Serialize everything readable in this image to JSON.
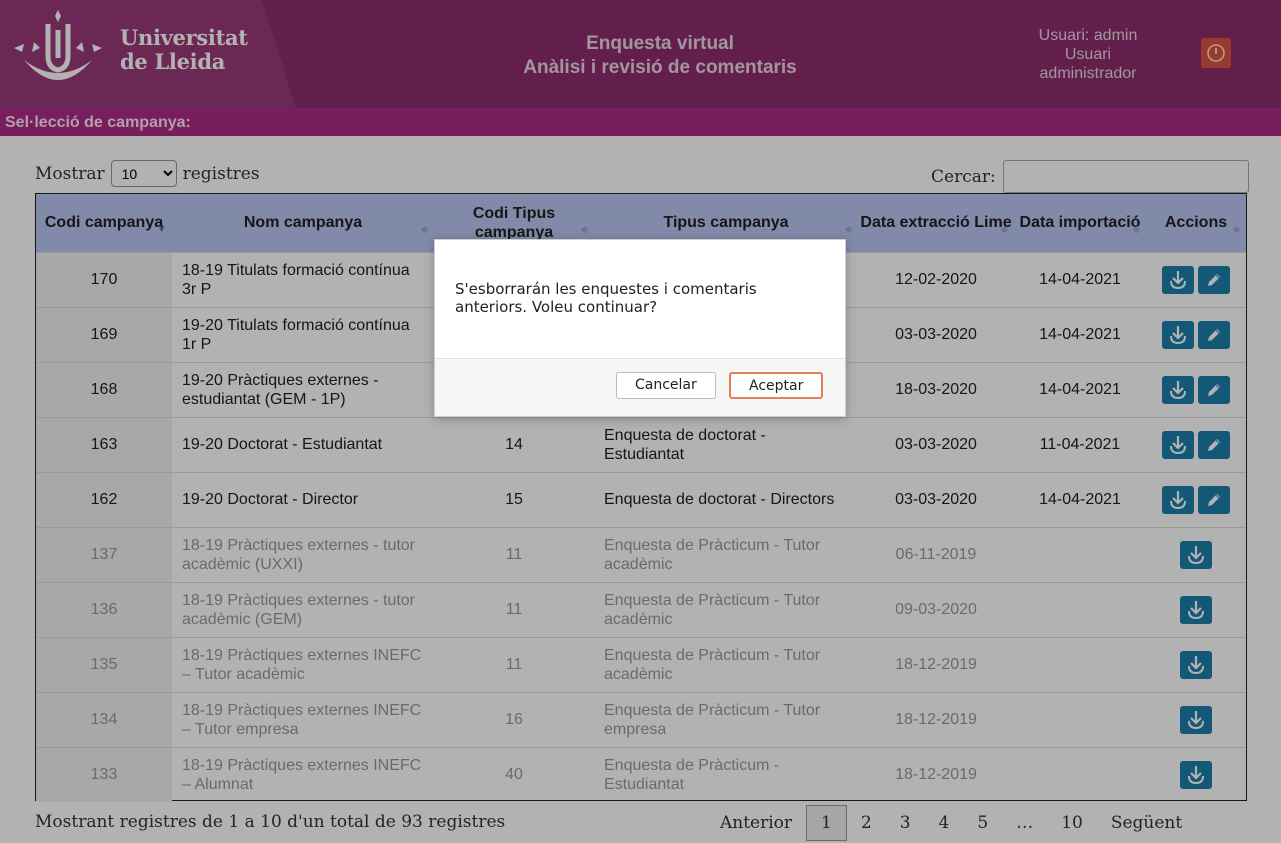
{
  "header": {
    "logo_line1": "Universitat",
    "logo_line2": "de Lleida",
    "title_line1": "Enquesta virtual",
    "title_line2": "Anàlisi i revisió de comentaris",
    "user_line1": "Usuari: admin",
    "user_line2": "Usuari",
    "user_line3": "administrador",
    "logout_icon": "power-icon"
  },
  "campaign_bar": {
    "label": "Sel·lecció de campanya:"
  },
  "controls": {
    "show_label": "Mostrar",
    "show_value": "10",
    "records_label": "registres",
    "search_label": "Cercar:",
    "search_value": ""
  },
  "table": {
    "headers": [
      "Codi campanya",
      "Nom campanya",
      "Codi Tipus campanya",
      "Tipus campanya",
      "Data extracció Lime",
      "Data importació",
      "Accions"
    ],
    "rows": [
      {
        "code": "170",
        "name": "18-19 Titulats formació contínua 3r P",
        "type_code": "",
        "type": "",
        "extract": "12-02-2020",
        "import": "14-04-2021",
        "editable": true
      },
      {
        "code": "169",
        "name": "19-20 Titulats formació contínua 1r P",
        "type_code": "",
        "type": "",
        "extract": "03-03-2020",
        "import": "14-04-2021",
        "editable": true
      },
      {
        "code": "168",
        "name": "19-20 Pràctiques externes - estudiantat (GEM - 1P)",
        "type_code": "",
        "type": "",
        "extract": "18-03-2020",
        "import": "14-04-2021",
        "editable": true
      },
      {
        "code": "163",
        "name": "19-20 Doctorat - Estudiantat",
        "type_code": "14",
        "type": "Enquesta de doctorat - Estudiantat",
        "extract": "03-03-2020",
        "import": "11-04-2021",
        "editable": true
      },
      {
        "code": "162",
        "name": "19-20 Doctorat - Director",
        "type_code": "15",
        "type": "Enquesta de doctorat - Directors",
        "extract": "03-03-2020",
        "import": "14-04-2021",
        "editable": true
      },
      {
        "code": "137",
        "name": "18-19 Pràctiques externes - tutor acadèmic (UXXI)",
        "type_code": "11",
        "type": "Enquesta de Pràcticum - Tutor acadèmic",
        "extract": "06-11-2019",
        "import": "",
        "editable": false
      },
      {
        "code": "136",
        "name": "18-19 Pràctiques externes - tutor acadèmic (GEM)",
        "type_code": "11",
        "type": "Enquesta de Pràcticum - Tutor acadèmic",
        "extract": "09-03-2020",
        "import": "",
        "editable": false
      },
      {
        "code": "135",
        "name": "18-19 Pràctiques externes INEFC – Tutor acadèmic",
        "type_code": "11",
        "type": "Enquesta de Pràcticum - Tutor acadèmic",
        "extract": "18-12-2019",
        "import": "",
        "editable": false
      },
      {
        "code": "134",
        "name": "18-19 Pràctiques externes INEFC – Tutor empresa",
        "type_code": "16",
        "type": "Enquesta de Pràcticum - Tutor empresa",
        "extract": "18-12-2019",
        "import": "",
        "editable": false
      },
      {
        "code": "133",
        "name": "18-19 Pràctiques externes INEFC – Alumnat",
        "type_code": "40",
        "type": "Enquesta de Pràcticum - Estudiantat",
        "extract": "18-12-2019",
        "import": "",
        "editable": false
      }
    ]
  },
  "footer": {
    "info": "Mostrant registres de 1 a 10 d'un total de 93 registres",
    "prev": "Anterior",
    "pages": [
      "1",
      "2",
      "3",
      "4",
      "5",
      "…",
      "10"
    ],
    "current_page": "1",
    "next": "Següent"
  },
  "dialog": {
    "message": "S'esborrarán les enquestes i comentaris anteriors. Voleu continuar?",
    "cancel_label": "Cancelar",
    "ok_label": "Aceptar"
  },
  "colors": {
    "header_bg": "#8e2d6e",
    "bar_bg": "#ad2b84",
    "table_header_bg": "#b9c6f2",
    "action_btn": "#1e7fad",
    "logout_btn": "#d8573f"
  }
}
